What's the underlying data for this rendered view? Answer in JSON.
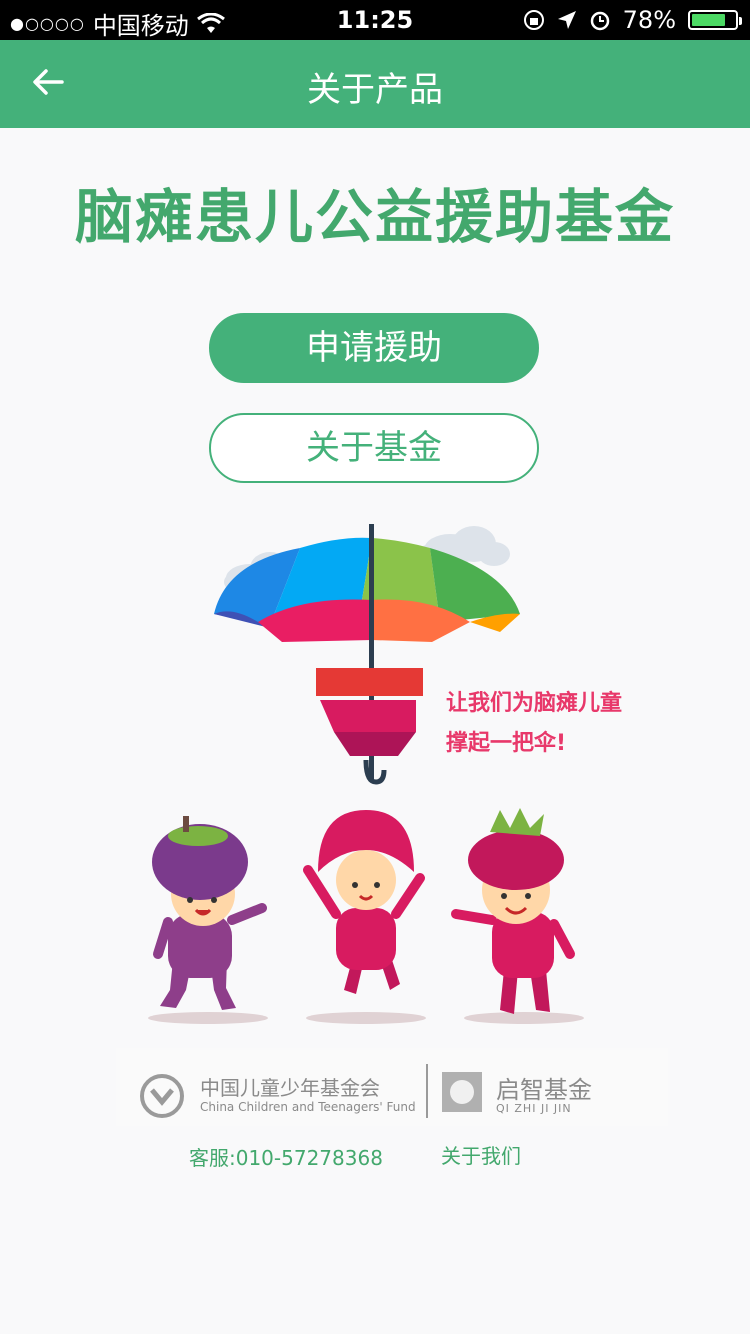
{
  "status_bar": {
    "carrier": "中国移动",
    "signal_dots": "●○○○○",
    "time": "11:25",
    "battery_percent": "78%",
    "battery_level": 0.78
  },
  "navbar": {
    "title": "关于产品"
  },
  "main": {
    "title": "脑瘫患儿公益援助基金",
    "apply_button": "申请援助",
    "about_fund_button": "关于基金",
    "slogan_line1": "让我们为脑瘫儿童",
    "slogan_line2": "撑起一把伞!"
  },
  "partners": {
    "org_a_cn": "中国儿童少年基金会",
    "org_a_en": "China Children and Teenagers' Fund",
    "org_b_cn": "启智基金",
    "org_b_en": "QI ZHI JI JIN"
  },
  "footer": {
    "service": "客服:010-57278368",
    "about_us": "关于我们"
  },
  "colors": {
    "brand_green": "#44b17a",
    "slogan_pink": "#e8386a"
  }
}
